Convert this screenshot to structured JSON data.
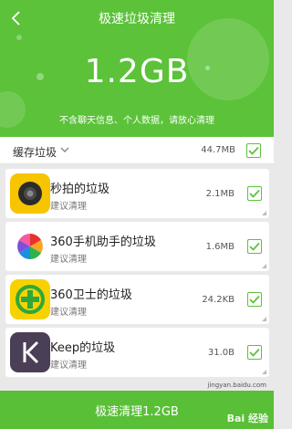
{
  "header": {
    "title": "极速垃圾清理",
    "total_size": "1.2GB",
    "subtitle": "不含聊天信息、个人数据，请放心清理"
  },
  "category": {
    "label": "缓存垃圾",
    "size": "44.7MB",
    "checked": true
  },
  "items": [
    {
      "name": "秒拍的垃圾",
      "hint": "建议清理",
      "size": "2.1MB",
      "checked": true,
      "icon": "miaopai-app-icon"
    },
    {
      "name": "360手机助手的垃圾",
      "hint": "建议清理",
      "size": "1.6MB",
      "checked": true,
      "icon": "360-assistant-app-icon"
    },
    {
      "name": "360卫士的垃圾",
      "hint": "建议清理",
      "size": "24.2KB",
      "checked": true,
      "icon": "360-security-app-icon"
    },
    {
      "name": "Keep的垃圾",
      "hint": "建议清理",
      "size": "31.0B",
      "checked": true,
      "icon": "keep-app-icon"
    }
  ],
  "action": {
    "label": "极速清理1.2GB"
  },
  "watermark": {
    "text": "Bai 经验",
    "url": "jingyan.baidu.com"
  },
  "colors": {
    "accent": "#5bc23a",
    "button": "#59bf37"
  }
}
